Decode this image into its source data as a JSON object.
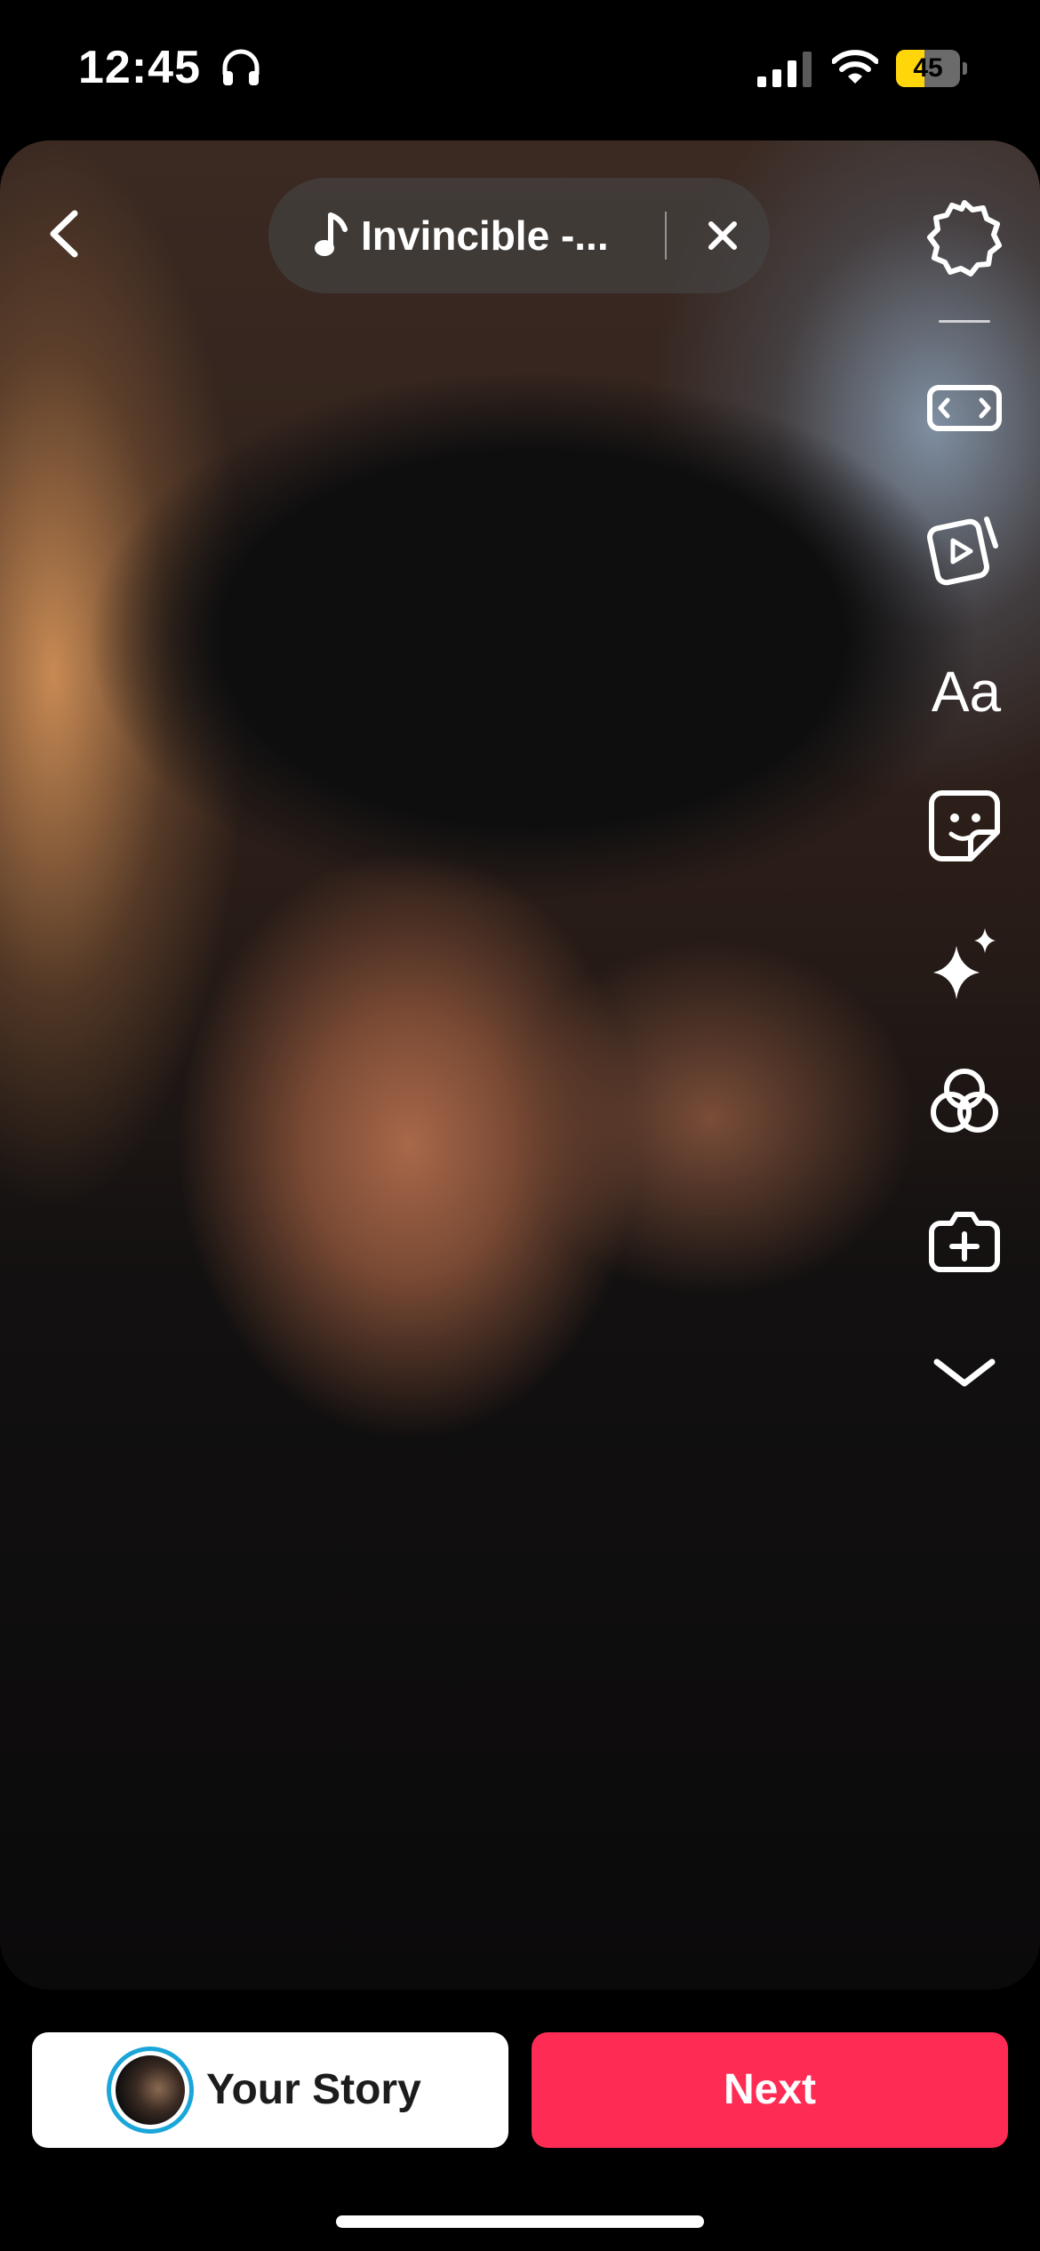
{
  "status_bar": {
    "time": "12:45",
    "battery_level": "45",
    "battery_fraction": 0.45,
    "icons": [
      "headphones-icon",
      "cellular-signal-icon",
      "wifi-icon",
      "battery-icon"
    ]
  },
  "music": {
    "title": "Invincible -...",
    "icon": "music-note-icon"
  },
  "toolbar": {
    "text_tool_label": "Aa",
    "icons": [
      "settings-icon",
      "aspect-ratio-icon",
      "video-templates-icon",
      "text-icon",
      "sticker-icon",
      "effects-icon",
      "filters-icon",
      "add-clip-icon",
      "chevron-down-icon"
    ]
  },
  "bottom": {
    "your_story_label": "Your Story",
    "next_label": "Next"
  },
  "colors": {
    "next_button": "#fe2c55",
    "story_ring": "#1aa6d8",
    "battery_fill": "#ffd60a"
  }
}
